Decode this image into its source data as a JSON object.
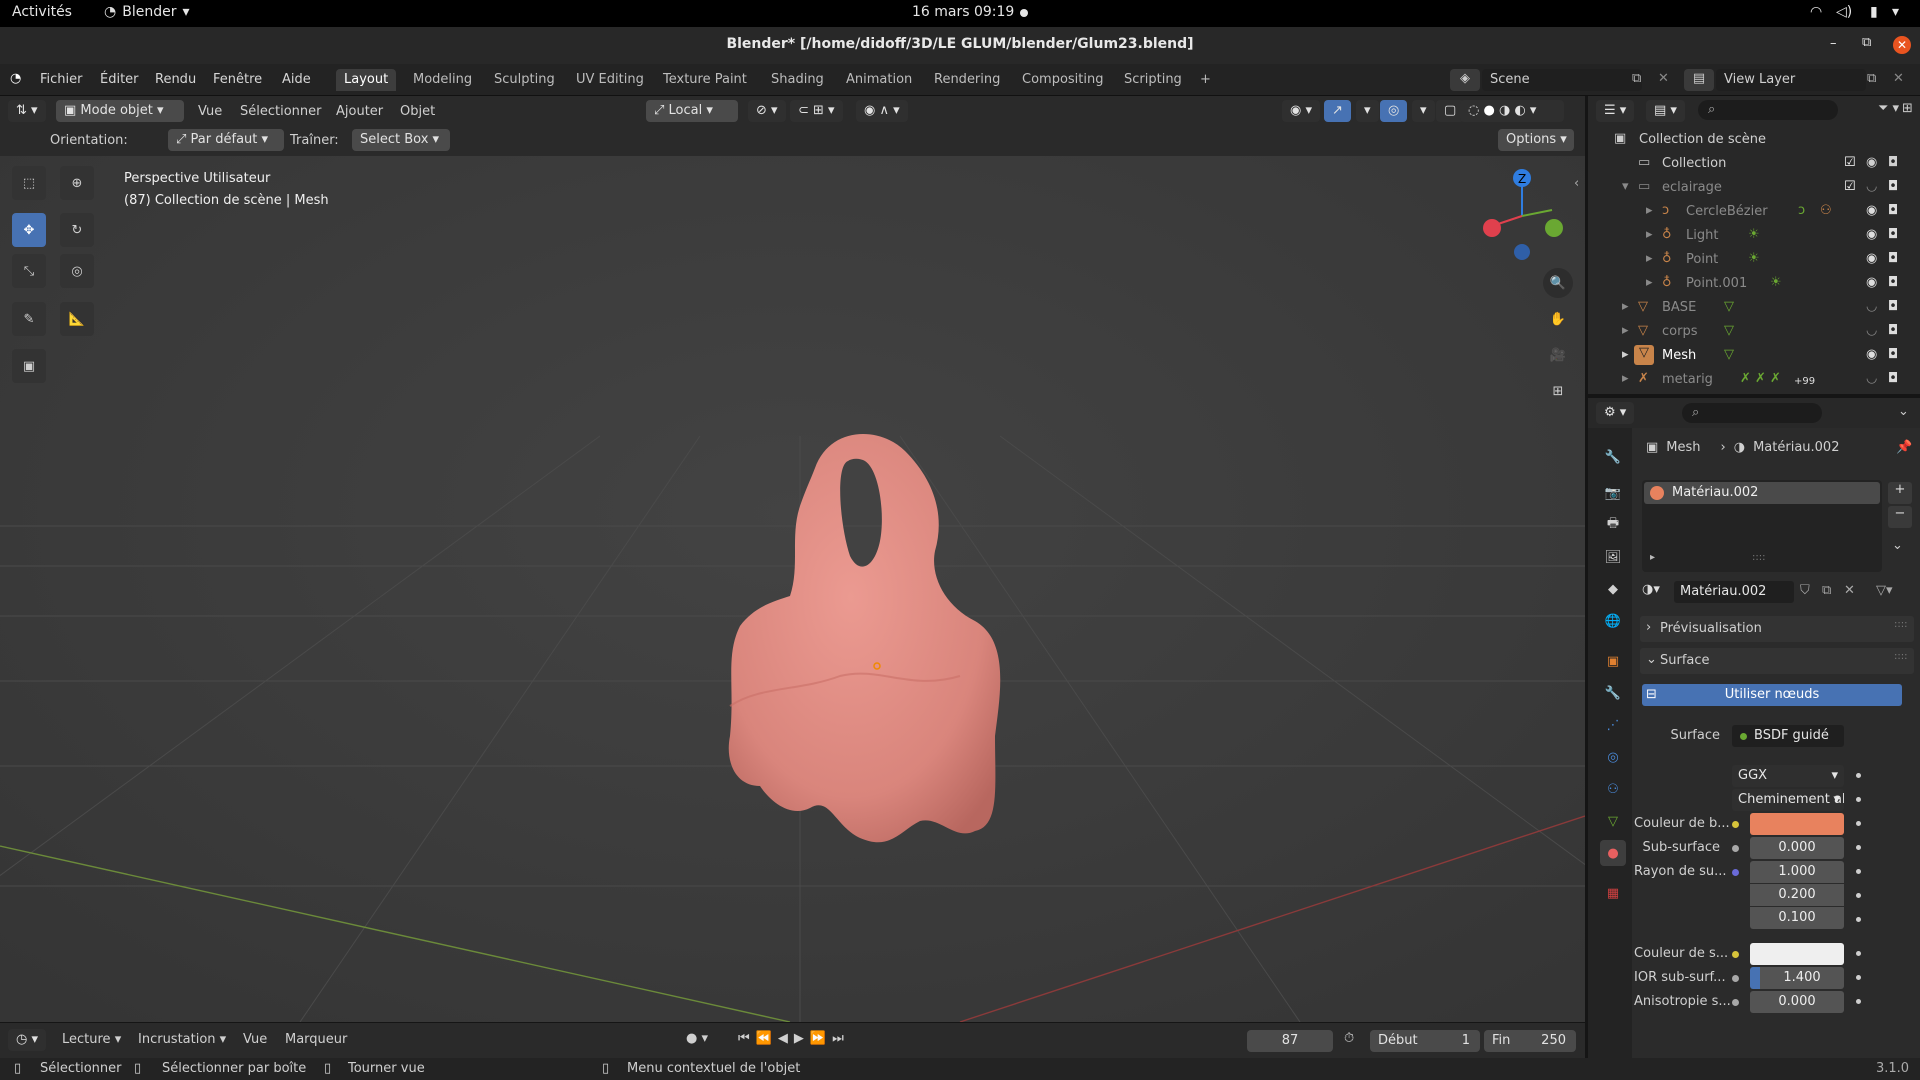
{
  "system_bar": {
    "activities": "Activités",
    "app": "Blender",
    "datetime": "16 mars  09:19"
  },
  "window": {
    "title": "Blender* [/home/didoff/3D/LE GLUM/blender/Glum23.blend]"
  },
  "menu": {
    "items": [
      "Fichier",
      "Éditer",
      "Rendu",
      "Fenêtre",
      "Aide"
    ]
  },
  "workspaces": [
    "Layout",
    "Modeling",
    "Sculpting",
    "UV Editing",
    "Texture Paint",
    "Shading",
    "Animation",
    "Rendering",
    "Compositing",
    "Scripting"
  ],
  "workspace_add": "+",
  "scene": {
    "name": "Scene",
    "view_layer": "View Layer"
  },
  "viewport_header": {
    "mode": "Mode objet",
    "menus": [
      "Vue",
      "Sélectionner",
      "Ajouter",
      "Objet"
    ],
    "transform": "Local",
    "options": "Options"
  },
  "viewport_header2": {
    "orientation_label": "Orientation:",
    "orientation_value": "Par défaut",
    "drag_label": "Traîner:",
    "drag_value": "Select Box"
  },
  "viewport_info": {
    "line1": "Perspective Utilisateur",
    "line2": "(87) Collection de scène | Mesh"
  },
  "gizmo": {
    "z": "Z"
  },
  "outliner": {
    "root": "Collection de scène",
    "rows": [
      {
        "name": "Collection",
        "level": 1,
        "dim": false
      },
      {
        "name": "eclairage",
        "level": 1,
        "dim": true
      },
      {
        "name": "CercleBézier",
        "level": 2,
        "dim": true
      },
      {
        "name": "Light",
        "level": 2,
        "dim": true
      },
      {
        "name": "Point",
        "level": 2,
        "dim": true
      },
      {
        "name": "Point.001",
        "level": 2,
        "dim": true
      },
      {
        "name": "BASE",
        "level": 1,
        "dim": true
      },
      {
        "name": "corps",
        "level": 1,
        "dim": true
      },
      {
        "name": "Mesh",
        "level": 1,
        "dim": false
      },
      {
        "name": "metarig",
        "level": 1,
        "dim": true
      }
    ],
    "metarig_badge": "+99"
  },
  "properties": {
    "breadcrumb_object": "Mesh",
    "breadcrumb_material": "Matériau.002",
    "slot": "Matériau.002",
    "material_name": "Matériau.002",
    "section_preview": "Prévisualisation",
    "section_surface": "Surface",
    "use_nodes": "Utiliser nœuds",
    "surface_label": "Surface",
    "surface_value": "BSDF guidé",
    "distribution": "GGX",
    "subsurface_method": "Cheminement al...",
    "fields": [
      {
        "label": "Couleur de b...",
        "value": "",
        "color": "#e8825e",
        "dot": "#d6c33a"
      },
      {
        "label": "Sub-surface",
        "value": "0.000",
        "dot": "#a8a8a8"
      },
      {
        "label": "Rayon de su...",
        "value": "1.000",
        "dot": "#6a6ad8"
      },
      {
        "label": "",
        "value": "0.200"
      },
      {
        "label": "",
        "value": "0.100"
      },
      {
        "label": "Couleur de s...",
        "value": "",
        "color": "#efefef",
        "dot": "#d6c33a"
      },
      {
        "label": "IOR sub-surf...",
        "value": "1.400",
        "dot": "#a8a8a8"
      },
      {
        "label": "Anisotropie s...",
        "value": "0.000",
        "dot": "#a8a8a8"
      }
    ]
  },
  "timeline": {
    "menus": [
      "Lecture",
      "Incrustation",
      "Vue",
      "Marqueur"
    ],
    "current_frame": "87",
    "start_label": "Début",
    "start": "1",
    "end_label": "Fin",
    "end": "250"
  },
  "status": {
    "select": "Sélectionner",
    "box_select": "Sélectionner par boîte",
    "rotate": "Tourner vue",
    "context": "Menu contextuel de l'objet",
    "version": "3.1.0"
  },
  "colors": {
    "accent": "#4772b3",
    "mesh": "#e08a80",
    "base_color": "#e8825e"
  }
}
